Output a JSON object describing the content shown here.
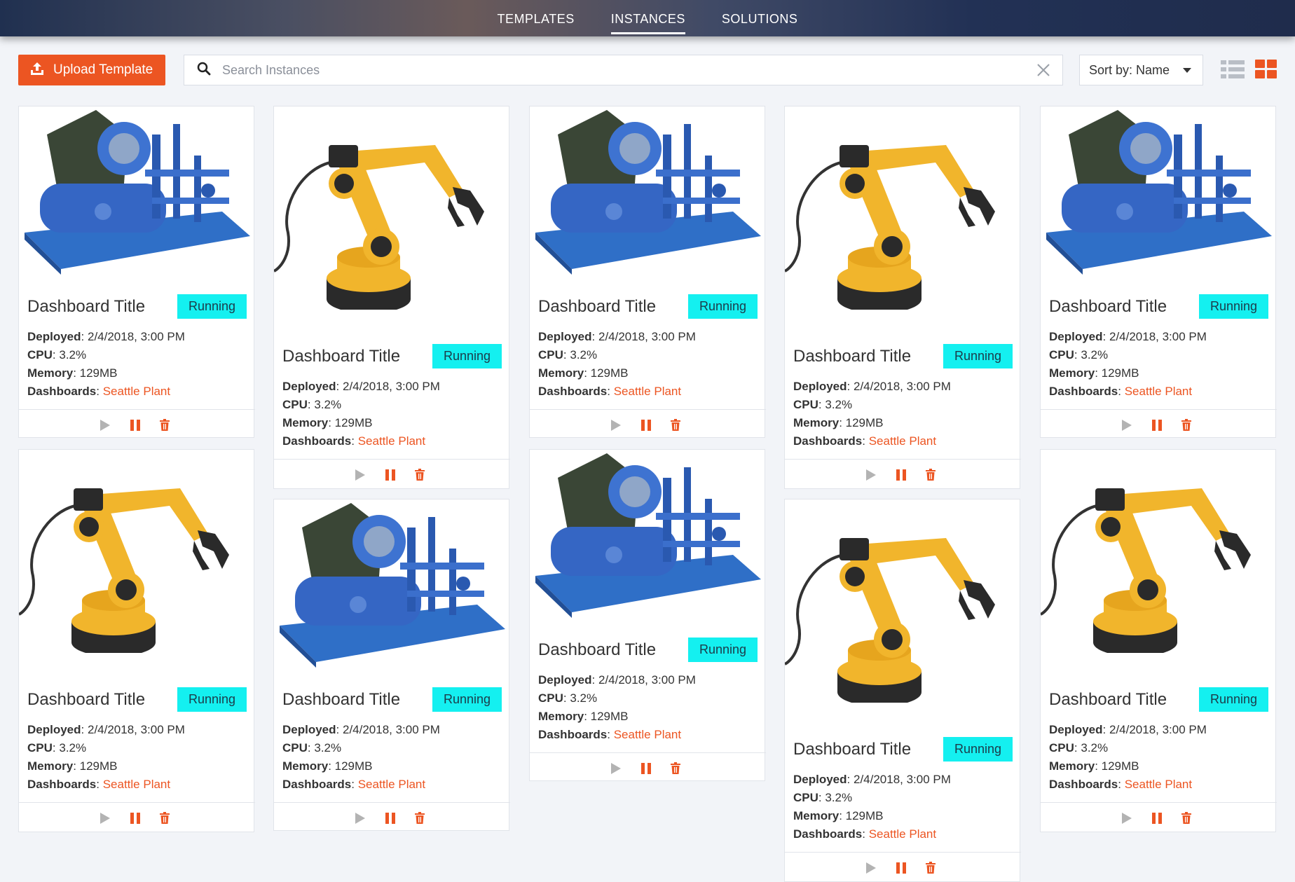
{
  "nav": {
    "tabs": [
      {
        "label": "TEMPLATES",
        "active": false
      },
      {
        "label": "INSTANCES",
        "active": true
      },
      {
        "label": "SOLUTIONS",
        "active": false
      }
    ]
  },
  "toolbar": {
    "upload_label": "Upload Template",
    "search_placeholder": "Search Instances",
    "sort_label": "Sort by: Name"
  },
  "colors": {
    "accent": "#ec5522",
    "badge": "#14f0f0",
    "nav_dark": "#203050"
  },
  "cards": [
    {
      "image": "compressor-image",
      "title": "Dashboard Title",
      "status": "Running",
      "deployed_label": "Deployed",
      "deployed": "2/4/2018, 3:00 PM",
      "cpu_label": "CPU",
      "cpu": "3.2%",
      "memory_label": "Memory",
      "memory": "129MB",
      "dashboards_label": "Dashboards",
      "dashboards": "Seattle Plant"
    },
    {
      "image": "robot-arm-image",
      "title": "Dashboard Title",
      "status": "Running",
      "deployed_label": "Deployed",
      "deployed": "2/4/2018, 3:00 PM",
      "cpu_label": "CPU",
      "cpu": "3.2%",
      "memory_label": "Memory",
      "memory": "129MB",
      "dashboards_label": "Dashboards",
      "dashboards": "Seattle Plant"
    },
    {
      "image": "compressor-image",
      "title": "Dashboard Title",
      "status": "Running",
      "deployed_label": "Deployed",
      "deployed": "2/4/2018, 3:00 PM",
      "cpu_label": "CPU",
      "cpu": "3.2%",
      "memory_label": "Memory",
      "memory": "129MB",
      "dashboards_label": "Dashboards",
      "dashboards": "Seattle Plant"
    },
    {
      "image": "robot-arm-image",
      "title": "Dashboard Title",
      "status": "Running",
      "deployed_label": "Deployed",
      "deployed": "2/4/2018, 3:00 PM",
      "cpu_label": "CPU",
      "cpu": "3.2%",
      "memory_label": "Memory",
      "memory": "129MB",
      "dashboards_label": "Dashboards",
      "dashboards": "Seattle Plant"
    },
    {
      "image": "compressor-image",
      "title": "Dashboard Title",
      "status": "Running",
      "deployed_label": "Deployed",
      "deployed": "2/4/2018, 3:00 PM",
      "cpu_label": "CPU",
      "cpu": "3.2%",
      "memory_label": "Memory",
      "memory": "129MB",
      "dashboards_label": "Dashboards",
      "dashboards": "Seattle Plant"
    },
    {
      "image": "robot-arm-image",
      "title": "Dashboard Title",
      "status": "Running",
      "deployed_label": "Deployed",
      "deployed": "2/4/2018, 3:00 PM",
      "cpu_label": "CPU",
      "cpu": "3.2%",
      "memory_label": "Memory",
      "memory": "129MB",
      "dashboards_label": "Dashboards",
      "dashboards": "Seattle Plant"
    },
    {
      "image": "compressor-image",
      "title": "Dashboard Title",
      "status": "Running",
      "deployed_label": "Deployed",
      "deployed": "2/4/2018, 3:00 PM",
      "cpu_label": "CPU",
      "cpu": "3.2%",
      "memory_label": "Memory",
      "memory": "129MB",
      "dashboards_label": "Dashboards",
      "dashboards": "Seattle Plant"
    },
    {
      "image": "compressor-image",
      "title": "Dashboard Title",
      "status": "Running",
      "deployed_label": "Deployed",
      "deployed": "2/4/2018, 3:00 PM",
      "cpu_label": "CPU",
      "cpu": "3.2%",
      "memory_label": "Memory",
      "memory": "129MB",
      "dashboards_label": "Dashboards",
      "dashboards": "Seattle Plant"
    },
    {
      "image": "robot-arm-image",
      "title": "Dashboard Title",
      "status": "Running",
      "deployed_label": "Deployed",
      "deployed": "2/4/2018, 3:00 PM",
      "cpu_label": "CPU",
      "cpu": "3.2%",
      "memory_label": "Memory",
      "memory": "129MB",
      "dashboards_label": "Dashboards",
      "dashboards": "Seattle Plant"
    },
    {
      "image": "robot-arm-image",
      "title": "Dashboard Title",
      "status": "Running",
      "deployed_label": "Deployed",
      "deployed": "2/4/2018, 3:00 PM",
      "cpu_label": "CPU",
      "cpu": "3.2%",
      "memory_label": "Memory",
      "memory": "129MB",
      "dashboards_label": "Dashboards",
      "dashboards": "Seattle Plant"
    }
  ]
}
